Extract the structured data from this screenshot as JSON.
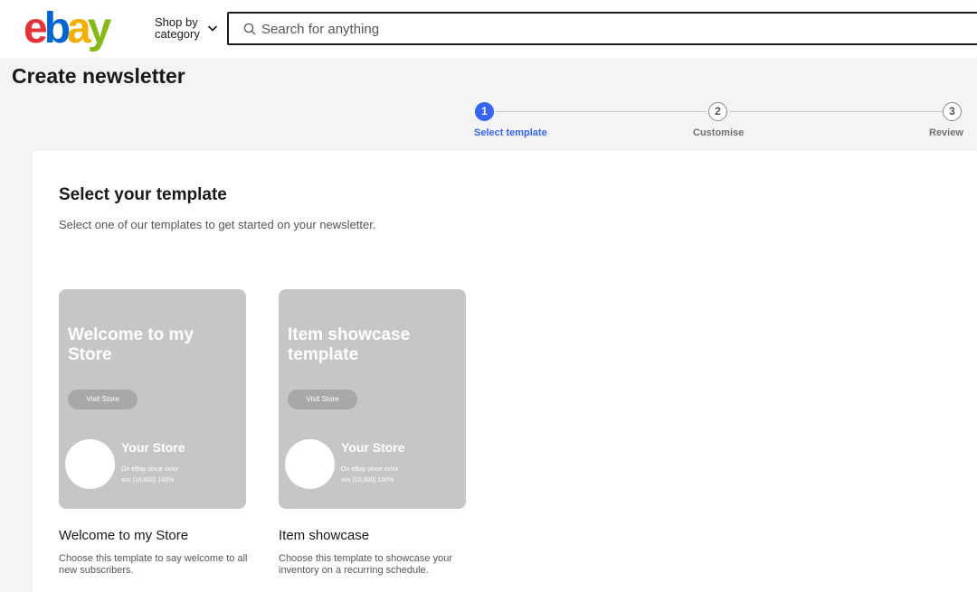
{
  "header": {
    "logo_letters": [
      {
        "char": "e",
        "color": "#e53238"
      },
      {
        "char": "b",
        "color": "#0064d2"
      },
      {
        "char": "a",
        "color": "#f5af02"
      },
      {
        "char": "y",
        "color": "#86b817"
      }
    ],
    "shop_by_label": "Shop by category",
    "shop_by_icon": "chevron-down-icon",
    "search_icon": "search-icon",
    "search_placeholder": "Search for anything"
  },
  "page": {
    "title": "Create newsletter"
  },
  "stepper": {
    "steps": [
      {
        "number": "1",
        "label": "Select template",
        "state": "active"
      },
      {
        "number": "2",
        "label": "Customise",
        "state": "pending"
      },
      {
        "number": "3",
        "label": "Review",
        "state": "pending"
      }
    ],
    "active_color": "#3665f3"
  },
  "content": {
    "title": "Select your template",
    "subtitle": "Select one of our templates to get started on your newsletter.",
    "templates": [
      {
        "preview_headline": "Welcome to my Store",
        "preview_button": "Visit Store",
        "preview_store_name": "Your Store",
        "preview_meta_line1": "On eBay since xx/xx",
        "preview_meta_line2": "xxx (10,000) 100%",
        "name": "Welcome to my Store",
        "description": "Choose this template to say welcome to all new subscribers."
      },
      {
        "preview_headline": "Item showcase template",
        "preview_button": "Visit Store",
        "preview_store_name": "Your Store",
        "preview_meta_line1": "On eBay since xx/xx",
        "preview_meta_line2": "xxx (10,000) 100%",
        "name": "Item showcase",
        "description": "Choose this template to showcase your inventory on a recurring schedule."
      }
    ]
  }
}
